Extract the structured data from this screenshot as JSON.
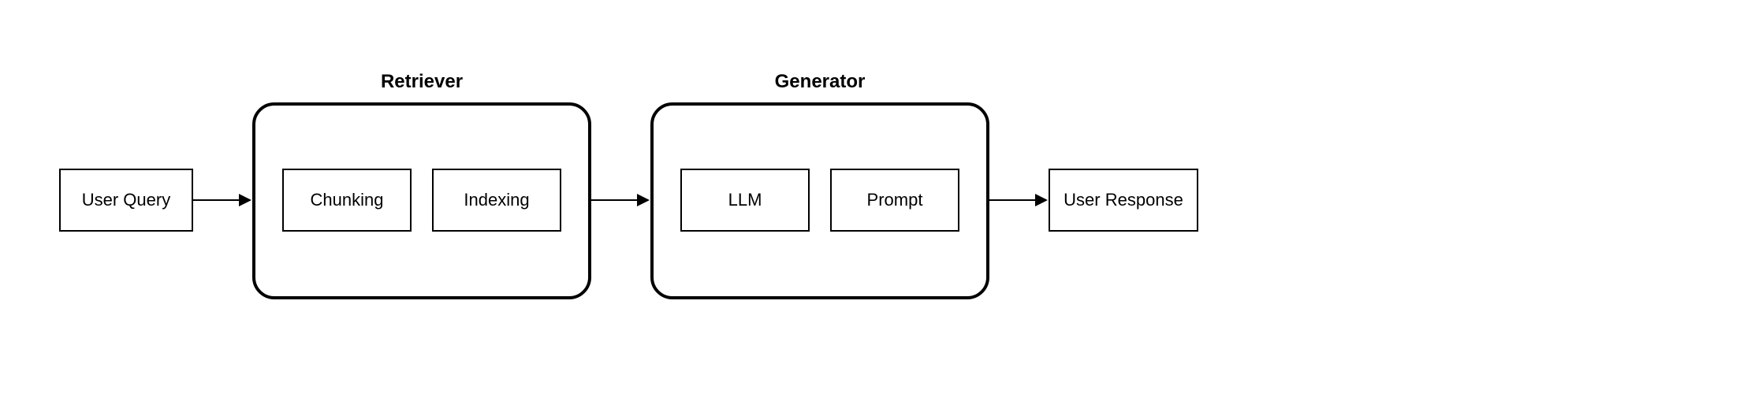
{
  "nodes": {
    "user_query": "User Query",
    "user_response": "User Response"
  },
  "groups": {
    "retriever": {
      "label": "Retriever",
      "children": {
        "chunking": "Chunking",
        "indexing": "Indexing"
      }
    },
    "generator": {
      "label": "Generator",
      "children": {
        "llm": "LLM",
        "prompt": "Prompt"
      }
    }
  }
}
